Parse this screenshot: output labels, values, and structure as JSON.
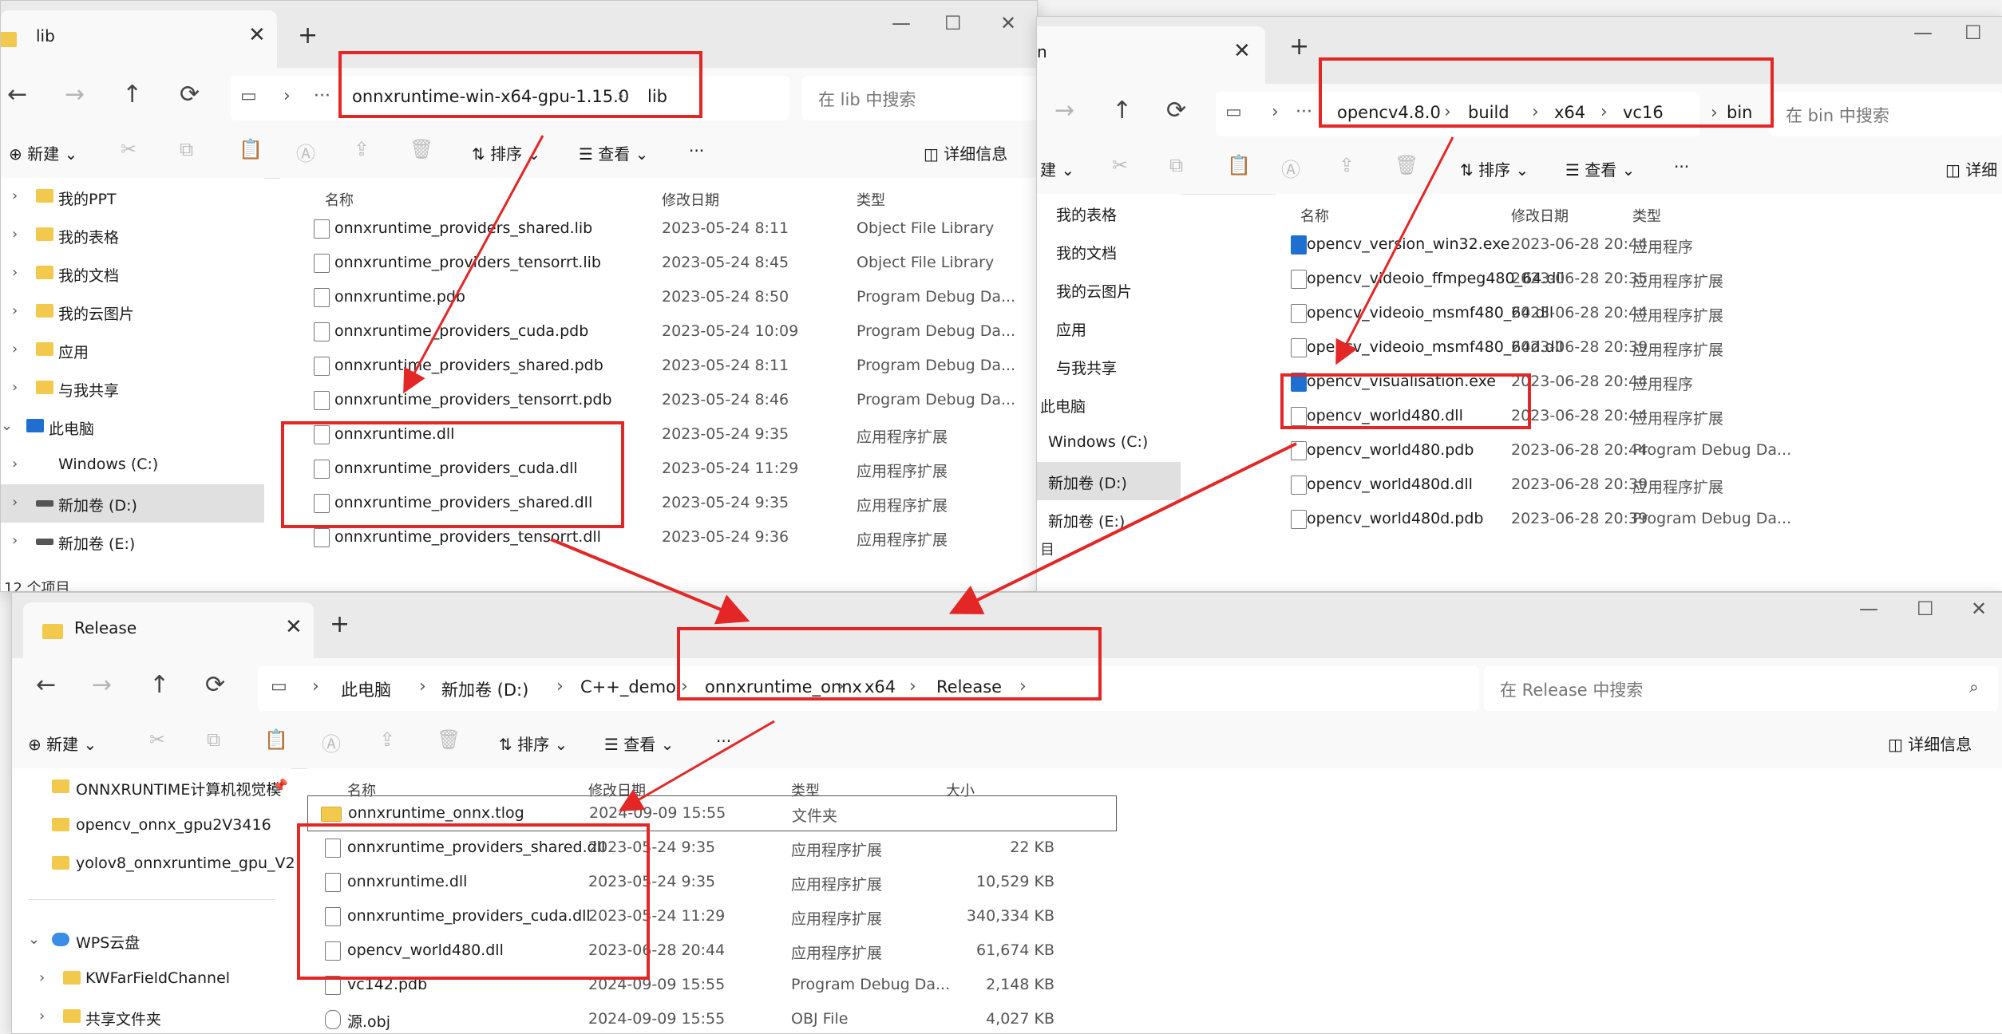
{
  "lib": {
    "tab_label": "lib",
    "path": [
      "onnxruntime-win-x64-gpu-1.15.0",
      "lib"
    ],
    "search_placeholder": "在 lib 中搜索",
    "toolbar": {
      "new": "新建",
      "sort": "排序",
      "view": "查看",
      "more": "···",
      "details": "详细信息"
    },
    "nav_items": [
      "我的PPT",
      "我的表格",
      "我的文档",
      "我的云图片",
      "应用",
      "与我共享",
      "此电脑",
      "Windows (C:)",
      "新加卷 (D:)",
      "新加卷 (E:)"
    ],
    "columns": {
      "name": "名称",
      "date": "修改日期",
      "type": "类型"
    },
    "files": [
      {
        "name": "onnxruntime_providers_shared.lib",
        "date": "2023-05-24 8:11",
        "type": "Object File Library"
      },
      {
        "name": "onnxruntime_providers_tensorrt.lib",
        "date": "2023-05-24 8:45",
        "type": "Object File Library"
      },
      {
        "name": "onnxruntime.pdb",
        "date": "2023-05-24 8:50",
        "type": "Program Debug Da..."
      },
      {
        "name": "onnxruntime_providers_cuda.pdb",
        "date": "2023-05-24 10:09",
        "type": "Program Debug Da..."
      },
      {
        "name": "onnxruntime_providers_shared.pdb",
        "date": "2023-05-24 8:11",
        "type": "Program Debug Da..."
      },
      {
        "name": "onnxruntime_providers_tensorrt.pdb",
        "date": "2023-05-24 8:46",
        "type": "Program Debug Da..."
      },
      {
        "name": "onnxruntime.dll",
        "date": "2023-05-24 9:35",
        "type": "应用程序扩展"
      },
      {
        "name": "onnxruntime_providers_cuda.dll",
        "date": "2023-05-24 11:29",
        "type": "应用程序扩展"
      },
      {
        "name": "onnxruntime_providers_shared.dll",
        "date": "2023-05-24 9:35",
        "type": "应用程序扩展"
      },
      {
        "name": "onnxruntime_providers_tensorrt.dll",
        "date": "2023-05-24 9:36",
        "type": "应用程序扩展"
      }
    ],
    "status": "12 个项目"
  },
  "bin": {
    "tab_label": "n",
    "path": [
      "opencv4.8.0",
      "build",
      "x64",
      "vc16",
      "bin"
    ],
    "search_placeholder": "在 bin 中搜索",
    "toolbar": {
      "new": "建",
      "sort": "排序",
      "view": "查看",
      "more": "···",
      "details": "详细"
    },
    "nav_items": [
      "我的表格",
      "我的文档",
      "我的云图片",
      "应用",
      "与我共享",
      "此电脑",
      "Windows (C:)",
      "新加卷 (D:)",
      "新加卷 (E:)"
    ],
    "columns": {
      "name": "名称",
      "date": "修改日期",
      "type": "类型"
    },
    "files": [
      {
        "name": "opencv_version_win32.exe",
        "date": "2023-06-28 20:44",
        "type": "应用程序"
      },
      {
        "name": "opencv_videoio_ffmpeg480_64.dll",
        "date": "2023-06-28 20:35",
        "type": "应用程序扩展"
      },
      {
        "name": "opencv_videoio_msmf480_64.dll",
        "date": "2023-06-28 20:44",
        "type": "应用程序扩展"
      },
      {
        "name": "opencv_videoio_msmf480_64d.dll",
        "date": "2023-06-28 20:39",
        "type": "应用程序扩展"
      },
      {
        "name": "opencv_visualisation.exe",
        "date": "2023-06-28 20:44",
        "type": "应用程序"
      },
      {
        "name": "opencv_world480.dll",
        "date": "2023-06-28 20:44",
        "type": "应用程序扩展"
      },
      {
        "name": "opencv_world480.pdb",
        "date": "2023-06-28 20:44",
        "type": "Program Debug Da..."
      },
      {
        "name": "opencv_world480d.dll",
        "date": "2023-06-28 20:39",
        "type": "应用程序扩展"
      },
      {
        "name": "opencv_world480d.pdb",
        "date": "2023-06-28 20:39",
        "type": "Program Debug Da..."
      }
    ],
    "status": "目"
  },
  "release": {
    "tab_label": "Release",
    "path": [
      "此电脑",
      "新加卷 (D:)",
      "C++_demo",
      "onnxruntime_onnx",
      "x64",
      "Release"
    ],
    "search_placeholder": "在 Release 中搜索",
    "toolbar": {
      "new": "新建",
      "sort": "排序",
      "view": "查看",
      "more": "···",
      "details": "详细信息"
    },
    "nav_items": [
      "ONNXRUNTIME计算机视觉模",
      "opencv_onnx_gpu2V3416",
      "yolov8_onnxruntime_gpu_V2",
      "WPS云盘",
      "KWFarFieldChannel",
      "共享文件夹"
    ],
    "columns": {
      "name": "名称",
      "date": "修改日期",
      "type": "类型",
      "size": "大小"
    },
    "files": [
      {
        "name": "onnxruntime_onnx.tlog",
        "date": "2024-09-09 15:55",
        "type": "文件夹",
        "size": ""
      },
      {
        "name": "onnxruntime_providers_shared.dll",
        "date": "2023-05-24 9:35",
        "type": "应用程序扩展",
        "size": "22 KB"
      },
      {
        "name": "onnxruntime.dll",
        "date": "2023-05-24 9:35",
        "type": "应用程序扩展",
        "size": "10,529 KB"
      },
      {
        "name": "onnxruntime_providers_cuda.dll",
        "date": "2023-05-24 11:29",
        "type": "应用程序扩展",
        "size": "340,334 KB"
      },
      {
        "name": "opencv_world480.dll",
        "date": "2023-06-28 20:44",
        "type": "应用程序扩展",
        "size": "61,674 KB"
      },
      {
        "name": "vc142.pdb",
        "date": "2024-09-09 15:55",
        "type": "Program Debug Da...",
        "size": "2,148 KB"
      },
      {
        "name": "源.obj",
        "date": "2024-09-09 15:55",
        "type": "OBJ File",
        "size": "4,027 KB"
      }
    ]
  },
  "colors": {
    "highlight": "#e32626",
    "folder": "#f2c94c",
    "accent": "#1f6fd1"
  }
}
